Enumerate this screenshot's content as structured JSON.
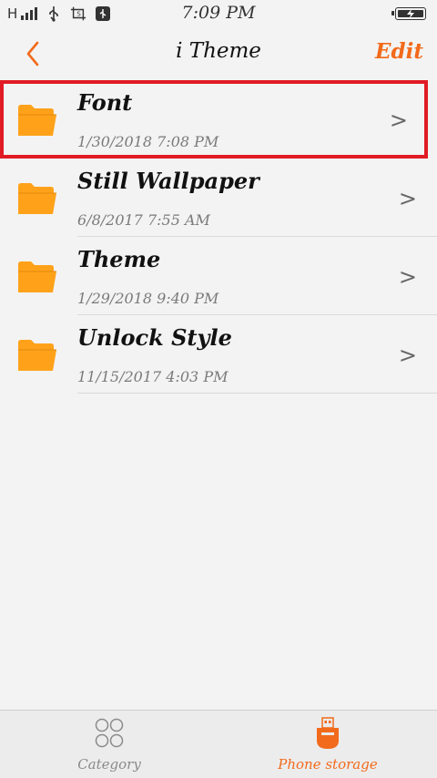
{
  "status_bar": {
    "network": "H",
    "time": "7:09 PM"
  },
  "header": {
    "title": "i Theme",
    "edit_label": "Edit"
  },
  "files": [
    {
      "name": "Font",
      "date": "1/30/2018 7:08 PM",
      "chevron": ">",
      "icon": "folder-icon"
    },
    {
      "name": "Still Wallpaper",
      "date": "6/8/2017 7:55 AM",
      "chevron": ">",
      "icon": "folder-icon"
    },
    {
      "name": "Theme",
      "date": "1/29/2018 9:40 PM",
      "chevron": ">",
      "icon": "folder-icon"
    },
    {
      "name": "Unlock Style",
      "date": "11/15/2017 4:03 PM",
      "chevron": ">",
      "icon": "folder-icon"
    }
  ],
  "tabs": {
    "category": {
      "label": "Category",
      "icon": "grid-circles-icon"
    },
    "storage": {
      "label": "Phone storage",
      "icon": "usb-drive-icon"
    }
  },
  "colors": {
    "accent": "#f26a1b",
    "folder": "#ffa21a",
    "highlight": "#e01b24",
    "background": "#f3f3f3"
  }
}
